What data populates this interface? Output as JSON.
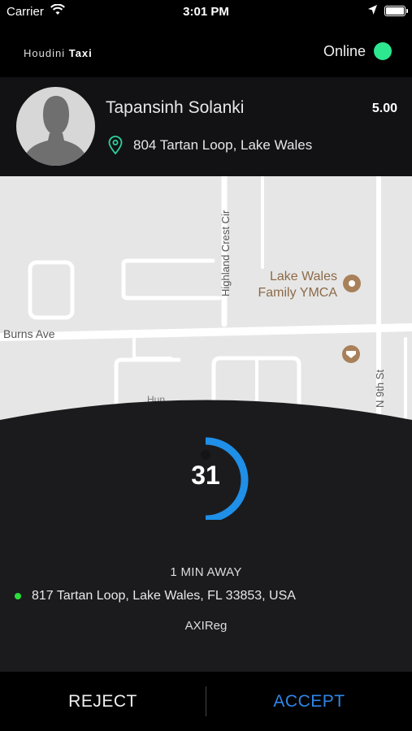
{
  "status_bar": {
    "carrier": "Carrier",
    "time": "3:01 PM"
  },
  "header": {
    "brand_light": "Houdini",
    "brand_bold": "Taxi",
    "status_label": "Online",
    "status_color": "#2ee88f"
  },
  "rider": {
    "name": "Tapansinh Solanki",
    "rating": "5.00",
    "pickup_address": "804 Tartan Loop, Lake Wales"
  },
  "map": {
    "street_1": "Burns Ave",
    "street_2": "Highland Crest Cir",
    "street_3": "N 9th St",
    "poi": "Lake Wales",
    "poi_line2": "Family YMCA",
    "partial_label": "Hun"
  },
  "request": {
    "countdown": "31",
    "eta": "1 MIN AWAY",
    "dropoff_address": "817 Tartan Loop, Lake Wales, FL 33853, USA",
    "vehicle": "AXIReg",
    "accent_color": "#1f8fe8"
  },
  "actions": {
    "reject_label": "REJECT",
    "accept_label": "ACCEPT"
  }
}
